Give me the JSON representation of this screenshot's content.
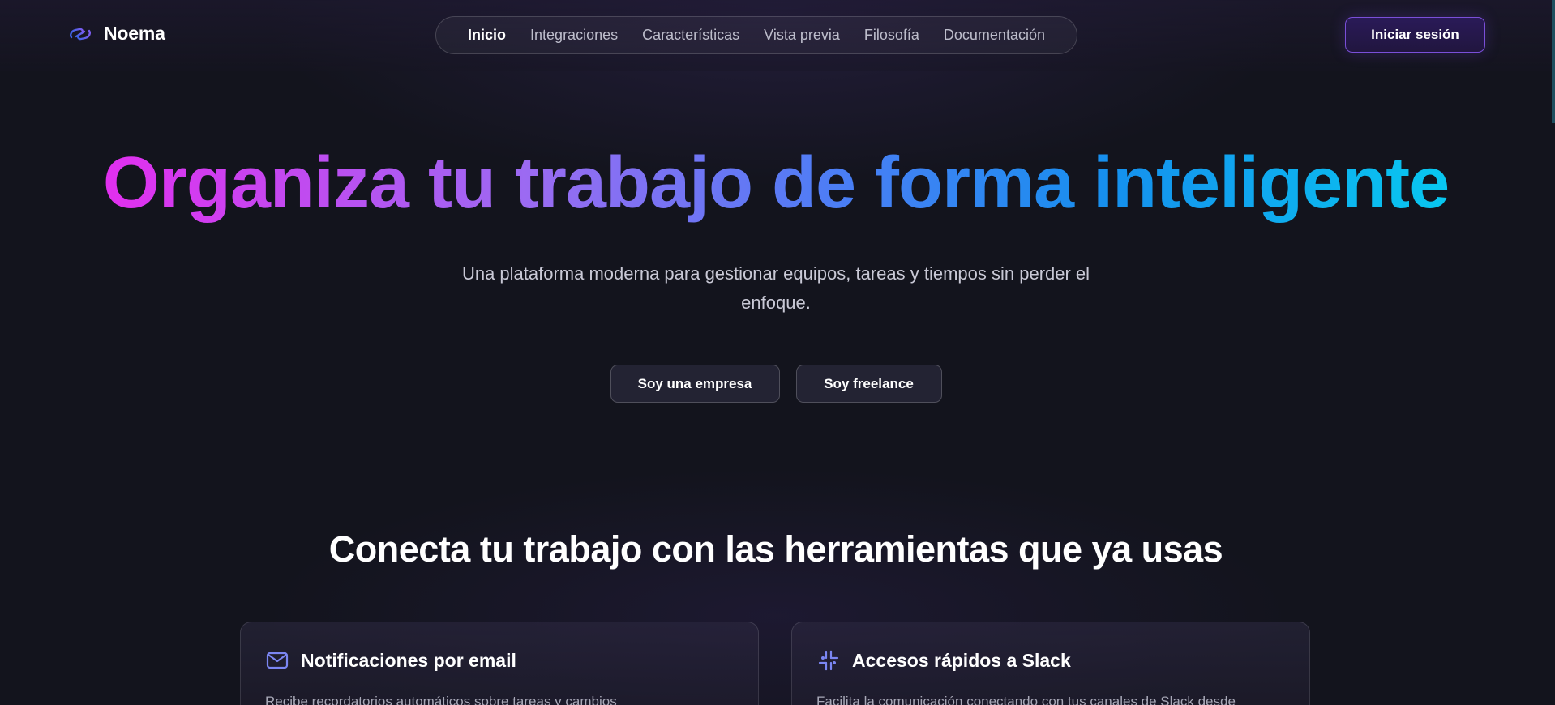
{
  "brand": {
    "name": "Noema",
    "icon": "link-icon"
  },
  "nav": {
    "items": [
      {
        "label": "Inicio",
        "active": true
      },
      {
        "label": "Integraciones",
        "active": false
      },
      {
        "label": "Características",
        "active": false
      },
      {
        "label": "Vista previa",
        "active": false
      },
      {
        "label": "Filosofía",
        "active": false
      },
      {
        "label": "Documentación",
        "active": false
      }
    ]
  },
  "header": {
    "login_label": "Iniciar sesión"
  },
  "hero": {
    "title": "Organiza tu trabajo de forma inteligente",
    "subtitle": "Una plataforma moderna para gestionar equipos, tareas y tiempos sin perder el enfoque.",
    "cta_empresa": "Soy una empresa",
    "cta_freelance": "Soy freelance"
  },
  "integrations": {
    "title": "Conecta tu trabajo con las herramientas que ya usas",
    "cards": [
      {
        "icon": "mail-icon",
        "title": "Notificaciones por email",
        "description": "Recibe recordatorios automáticos sobre tareas y cambios"
      },
      {
        "icon": "slack-icon",
        "title": "Accesos rápidos a Slack",
        "description": "Facilita la comunicación conectando con tus canales de Slack desde"
      }
    ]
  },
  "colors": {
    "background": "#13141d",
    "accent": "#7a4fd8",
    "gradient_start": "#e22fef",
    "gradient_end": "#08c8f0",
    "icon": "#7b86f2"
  }
}
